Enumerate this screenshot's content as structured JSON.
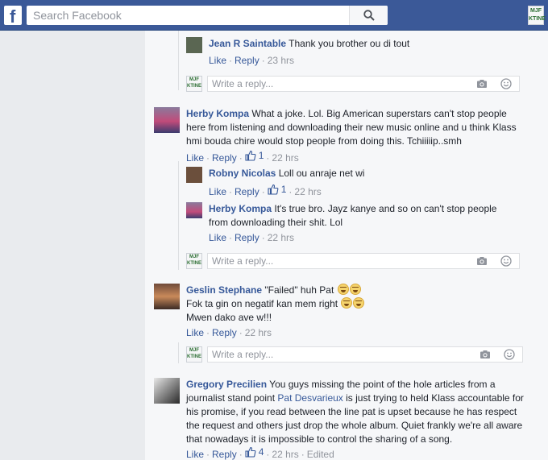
{
  "header": {
    "logo": "f",
    "search": {
      "placeholder": "Search Facebook"
    },
    "profile_badge": "MJF\nKTINE"
  },
  "reply_badge": "MJF\nKTINE",
  "reply_placeholder": "Write a reply...",
  "actions": {
    "like": "Like",
    "reply": "Reply",
    "sep": "·"
  },
  "comments": [
    {
      "author": "Jean R Saintable",
      "text": "Thank you brother ou di tout",
      "time": "23 hrs"
    },
    {
      "author": "Herby Kompa",
      "text": "What a joke. Lol. Big American superstars can't stop people here from listening and downloading their new music online and u think Klass hmi bouda chire would stop people from doing this. Tchiiiiip..smh",
      "likes": "1",
      "time": "22 hrs"
    },
    {
      "author": "Robny Nicolas",
      "text": "Loll ou anraje net wi",
      "likes": "1",
      "time": "22 hrs"
    },
    {
      "author": "Herby Kompa",
      "text": "It's true bro. Jayz kanye and so on can't stop people from downloading their shit. Lol",
      "time": "22 hrs"
    },
    {
      "author": "Geslin Stephane",
      "line1": "\"Failed\" huh Pat",
      "line2": "Fok ta gin on negatif kan mem right",
      "line3": "Mwen dako ave w!!!",
      "time": "22 hrs"
    },
    {
      "author": "Gregory Precilien",
      "text_before": "You guys missing the point of the hole articles from a journalist stand point",
      "mention": "Pat Desvarieux",
      "text_after": "is just trying to held Klass accountable for his promise, if you read between the line pat is upset because he has respect the request and others just drop the whole album. Quiet frankly we're all aware that nowadays it is impossible to control the sharing of a song.",
      "likes": "4",
      "time": "22 hrs",
      "edited": "Edited"
    }
  ],
  "colors": {
    "brand": "#3b5998",
    "link": "#365899",
    "muted": "#90949c",
    "page_bg": "#e9ebee",
    "panel_bg": "#f6f7f9"
  },
  "icons": [
    "search-icon",
    "thumbs-up-icon",
    "camera-icon",
    "emoji-icon",
    "laughing-emoji-icon"
  ]
}
